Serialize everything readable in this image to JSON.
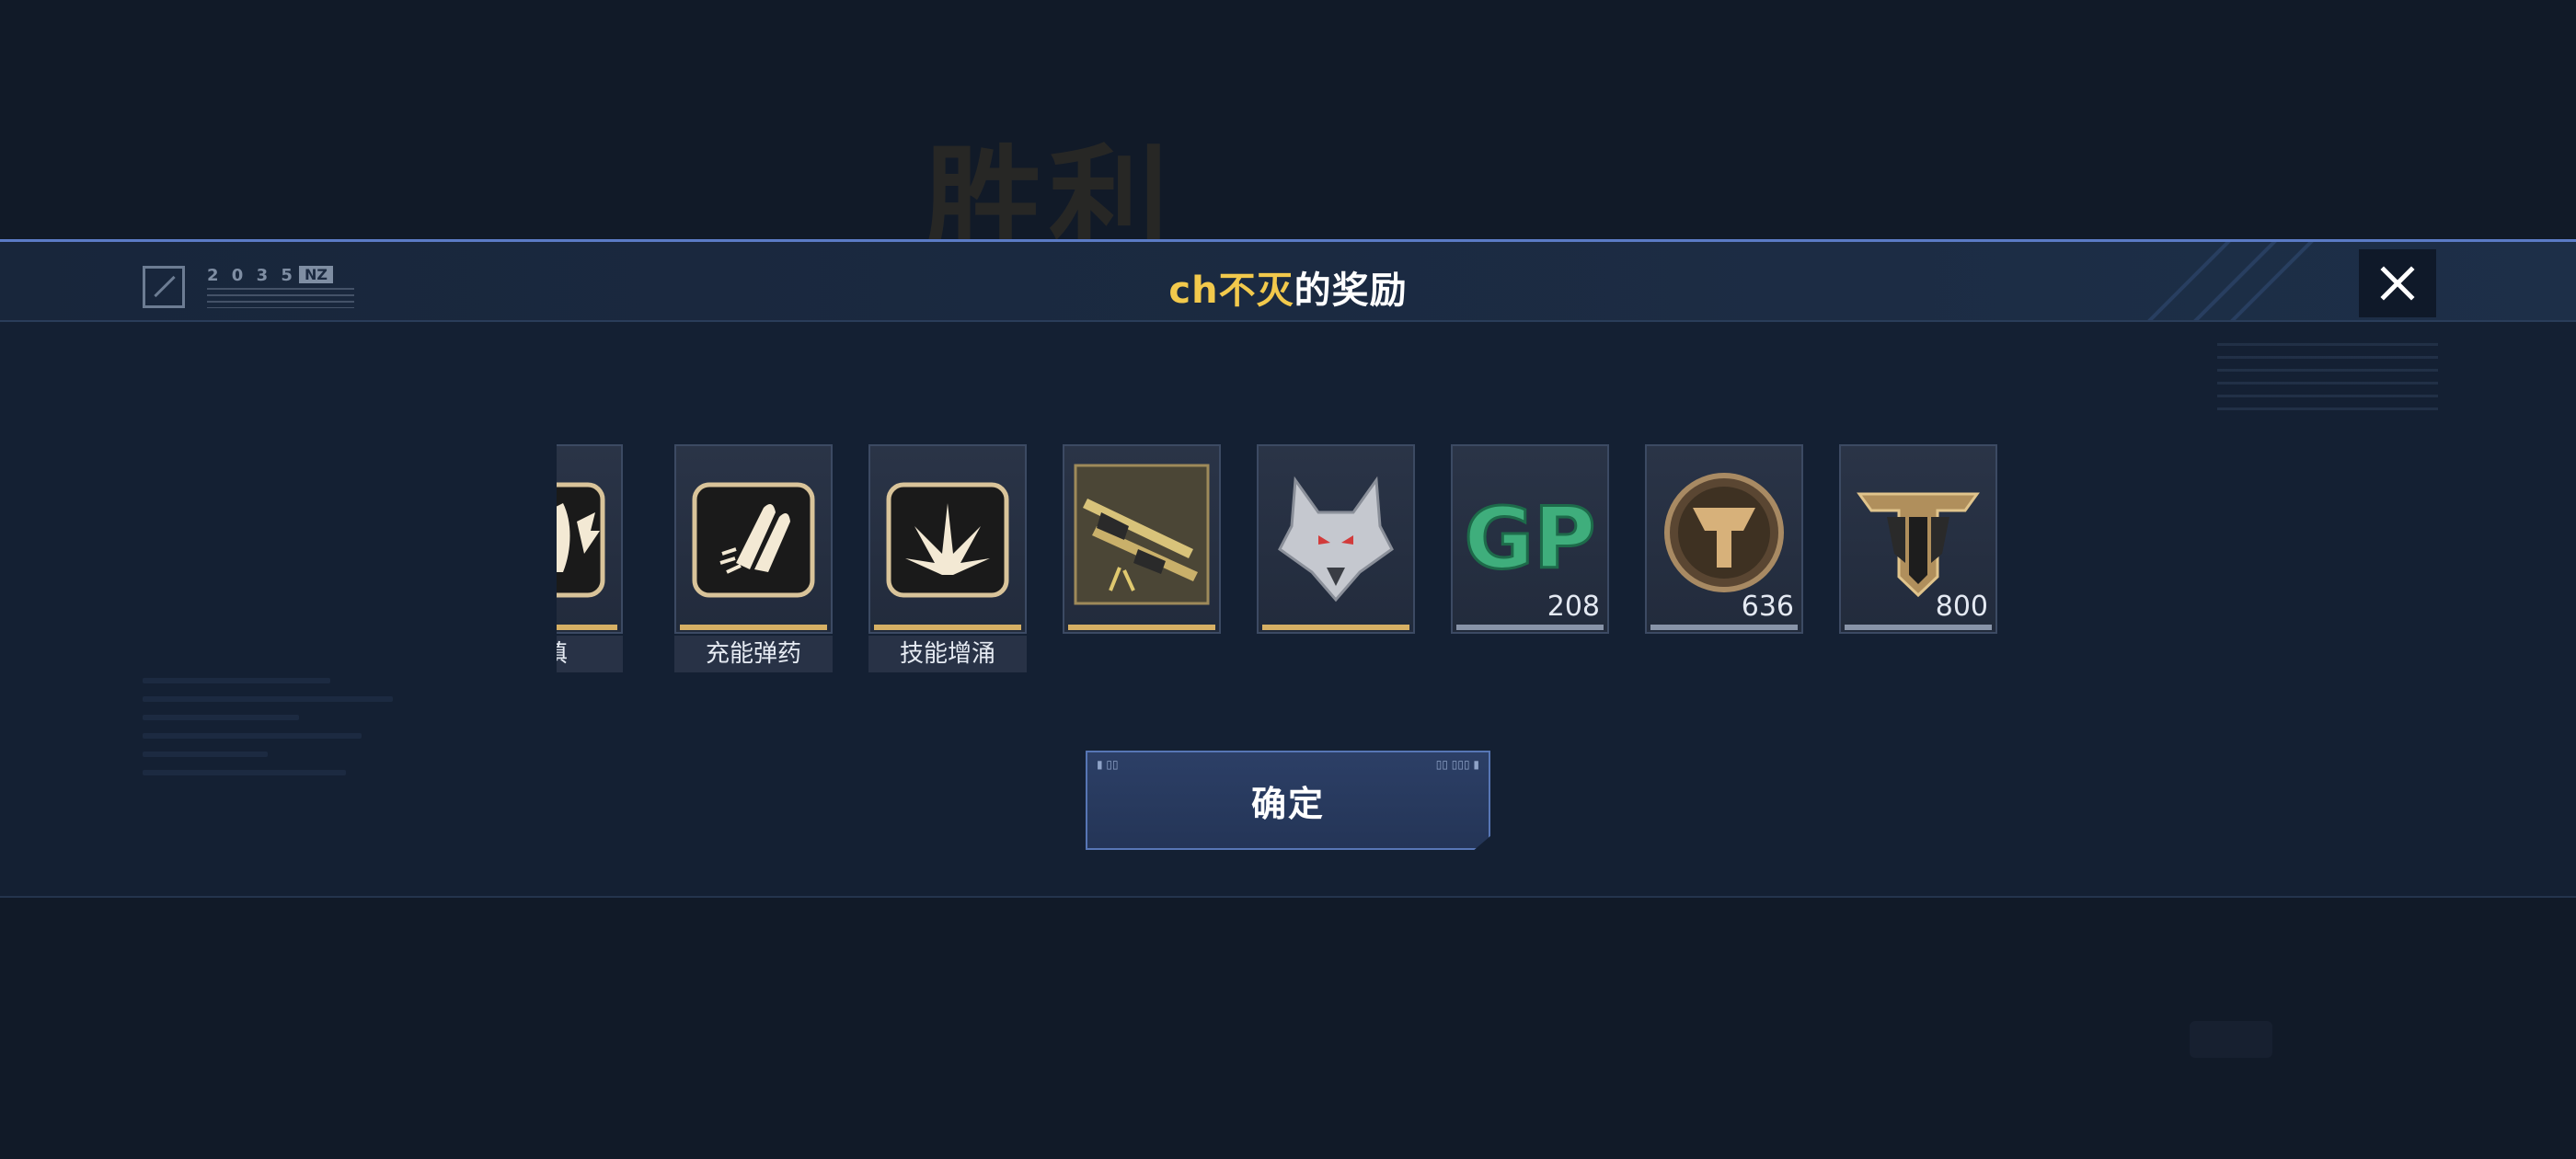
{
  "background": {
    "title": "胜利"
  },
  "header": {
    "logo_text": "2 0 3 5 -",
    "logo_tag": "NZ",
    "title_player": "ch不灭",
    "title_suffix": "的奖励"
  },
  "rewards": [
    {
      "label": "装填",
      "icon": "bullet-wing-reload-icon",
      "bar": "gold",
      "count": null
    },
    {
      "label": "充能弹药",
      "icon": "charged-ammo-icon",
      "bar": "gold",
      "count": null
    },
    {
      "label": "技能增涌",
      "icon": "skill-surge-icon",
      "bar": "gold",
      "count": null
    },
    {
      "label": "",
      "icon": "weapon-skin-icon",
      "bar": "gold",
      "count": null
    },
    {
      "label": "",
      "icon": "silver-wolf-head-icon",
      "bar": "gold",
      "count": null
    },
    {
      "label": "",
      "icon": "gp-currency-icon",
      "bar": "silver",
      "count": "208"
    },
    {
      "label": "",
      "icon": "bronze-medal-icon",
      "bar": "silver",
      "count": "636"
    },
    {
      "label": "",
      "icon": "rank-emblem-icon",
      "bar": "silver",
      "count": "800"
    }
  ],
  "confirm": {
    "label": "确定"
  },
  "colors": {
    "accent_gold": "#f2c94c",
    "rarity_gold": "#d6b064",
    "rarity_silver": "#8894a8",
    "band_border": "#5b7bc6"
  }
}
